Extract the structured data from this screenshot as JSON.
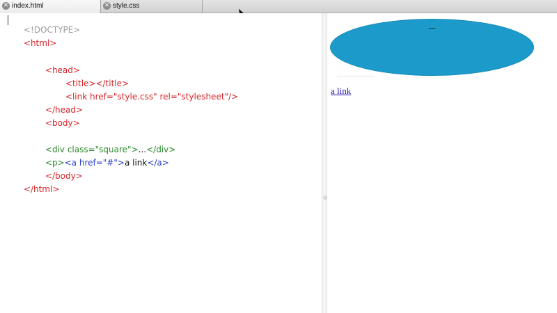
{
  "tabs": [
    {
      "label": "index.html",
      "active": true
    },
    {
      "label": "style.css",
      "active": false
    }
  ],
  "editor": {
    "lines": [
      [
        {
          "t": "<!DOCTYPE>",
          "c": "gray"
        }
      ],
      [
        {
          "t": "<html>",
          "c": "red"
        }
      ],
      [],
      [
        {
          "t": "<head>",
          "c": "red"
        }
      ],
      [
        {
          "t": "<title></title>",
          "c": "red"
        }
      ],
      [
        {
          "t": "<link href=\"style.css\" rel=\"stylesheet\"/>",
          "c": "red"
        }
      ],
      [
        {
          "t": "</head>",
          "c": "red"
        }
      ],
      [
        {
          "t": "<body>",
          "c": "red"
        }
      ],
      [],
      [
        {
          "t": "<div class=\"square\">",
          "c": "green"
        },
        {
          "t": "...",
          "c": "black"
        },
        {
          "t": "</div>",
          "c": "green"
        }
      ],
      [
        {
          "t": "<p>",
          "c": "green"
        },
        {
          "t": "<a href=\"#\">",
          "c": "blue"
        },
        {
          "t": "a link",
          "c": "black"
        },
        {
          "t": "</a>",
          "c": "blue"
        }
      ],
      [
        {
          "t": "</body>",
          "c": "red"
        }
      ],
      [
        {
          "t": "</html>",
          "c": "red"
        }
      ]
    ]
  },
  "preview": {
    "square_text": "...",
    "link_text": "a link"
  },
  "colors": {
    "tag_red": "#d6252a",
    "tag_green": "#2a8a2a",
    "tag_blue": "#2a3fcf",
    "square_fill": "#1c9bcb",
    "link": "#1a0dab"
  }
}
